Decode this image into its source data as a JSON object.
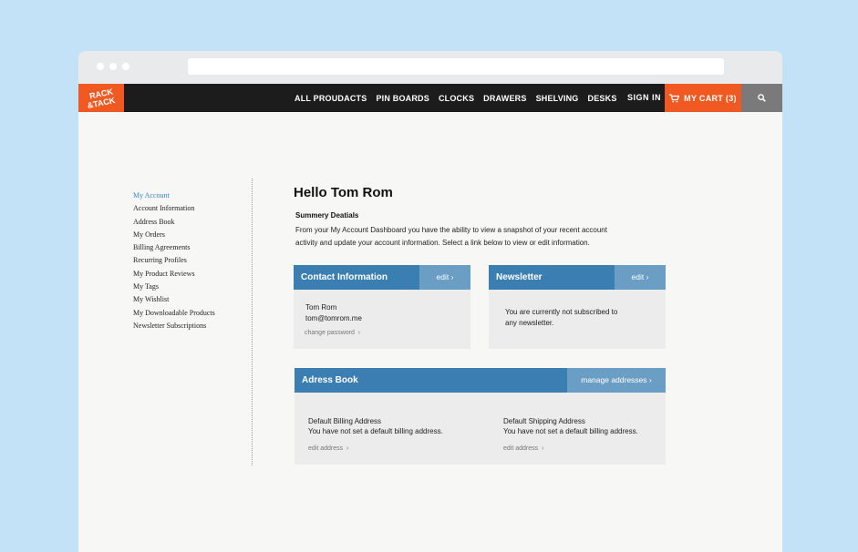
{
  "brand": {
    "line1": "RACK",
    "line2": "&TACK"
  },
  "nav": {
    "links": [
      "ALL PROUDACTS",
      "PIN BOARDS",
      "CLOCKS",
      "DRAWERS",
      "SHELVING",
      "DESKS"
    ],
    "sign_in": "SIGN IN",
    "cart": "MY CART (3)",
    "icons": [
      "cart-icon",
      "search-icon"
    ],
    "accent_color": "#f05a22"
  },
  "sidebar": {
    "items": [
      {
        "label": "My Account",
        "active": true
      },
      {
        "label": "Account Information"
      },
      {
        "label": "Address Book"
      },
      {
        "label": "My Orders"
      },
      {
        "label": "Billing Agreements"
      },
      {
        "label": "Recurring Profiles"
      },
      {
        "label": "My Product Reviews"
      },
      {
        "label": "My Tags"
      },
      {
        "label": "My Wishlist"
      },
      {
        "label": "My Downloadable Products"
      },
      {
        "label": "Newsletter Subscriptions"
      }
    ]
  },
  "main": {
    "greeting": "Hello Tom Rom",
    "summary_title": "Summery Deatials",
    "summary_text": "From your My Account Dashboard you have the ability to view a snapshot of your recent account activity and update your account information. Select a link below to view or edit information.",
    "contact": {
      "title": "Contact Information",
      "edit": "edit",
      "name": "Tom Rom",
      "email": "tom@tomrom.me",
      "change_password": "change password"
    },
    "newsletter": {
      "title": "Newsletter",
      "edit": "edit",
      "text": "You are currently not subscribed to any newsletter."
    },
    "address_book": {
      "title": "Adress Book",
      "manage": "manage addresses",
      "billing_title": "Default Billing Address",
      "billing_text": "You have not set a default billing address.",
      "billing_link": "edit address",
      "shipping_title": "Default Shipping Address",
      "shipping_text": "You have not set a default billing address.",
      "shipping_link": "edit address"
    },
    "panel_color": "#3b7fb2"
  }
}
